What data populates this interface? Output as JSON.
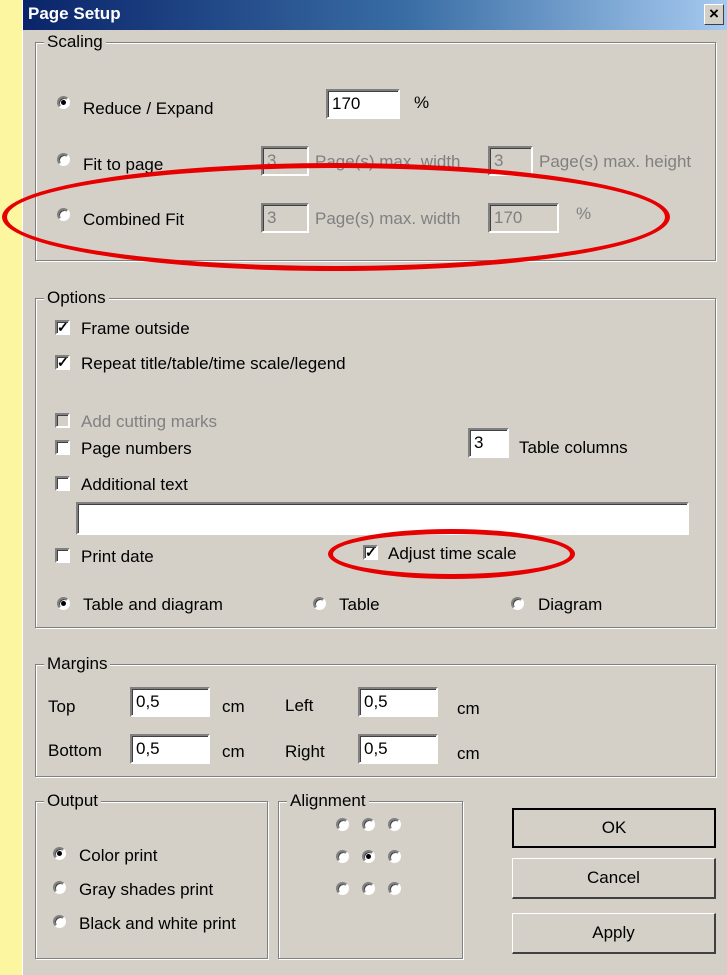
{
  "window": {
    "title": "Page Setup",
    "close_glyph": "×"
  },
  "scaling": {
    "legend": "Scaling",
    "reduce_expand_label": "Reduce / Expand",
    "reduce_expand_value": "170",
    "percent": "%",
    "fit_to_page_label": "Fit to page",
    "fit_width_value": "3",
    "max_width_label": "Page(s) max. width",
    "fit_height_value": "3",
    "max_height_label": "Page(s) max. height",
    "combined_fit_label": "Combined Fit",
    "combined_width_value": "3",
    "combined_percent_value": "170"
  },
  "options": {
    "legend": "Options",
    "frame_outside": "Frame outside",
    "repeat_title": "Repeat title/table/time scale/legend",
    "add_cutting_marks": "Add cutting marks",
    "page_numbers": "Page numbers",
    "table_columns_value": "3",
    "table_columns_label": "Table columns",
    "additional_text": "Additional text",
    "additional_text_value": "",
    "print_date": "Print date",
    "adjust_time_scale": "Adjust time scale",
    "table_and_diagram": "Table and diagram",
    "table": "Table",
    "diagram": "Diagram",
    "check_glyph": "✓"
  },
  "margins": {
    "legend": "Margins",
    "top_label": "Top",
    "top_value": "0,5",
    "left_label": "Left",
    "left_value": "0,5",
    "bottom_label": "Bottom",
    "bottom_value": "0,5",
    "right_label": "Right",
    "right_value": "0,5",
    "unit": "cm"
  },
  "output": {
    "legend": "Output",
    "color_print": "Color print",
    "gray_shades_print": "Gray shades print",
    "black_white_print": "Black and white print"
  },
  "alignment": {
    "legend": "Alignment",
    "selected": "center"
  },
  "buttons": {
    "ok": "OK",
    "cancel": "Cancel",
    "apply": "Apply"
  },
  "colors": {
    "dialog_bg": "#d4d0c8",
    "titlebar": "#0a246a",
    "annotation": "#e60000",
    "background": "#fcf6a0"
  }
}
